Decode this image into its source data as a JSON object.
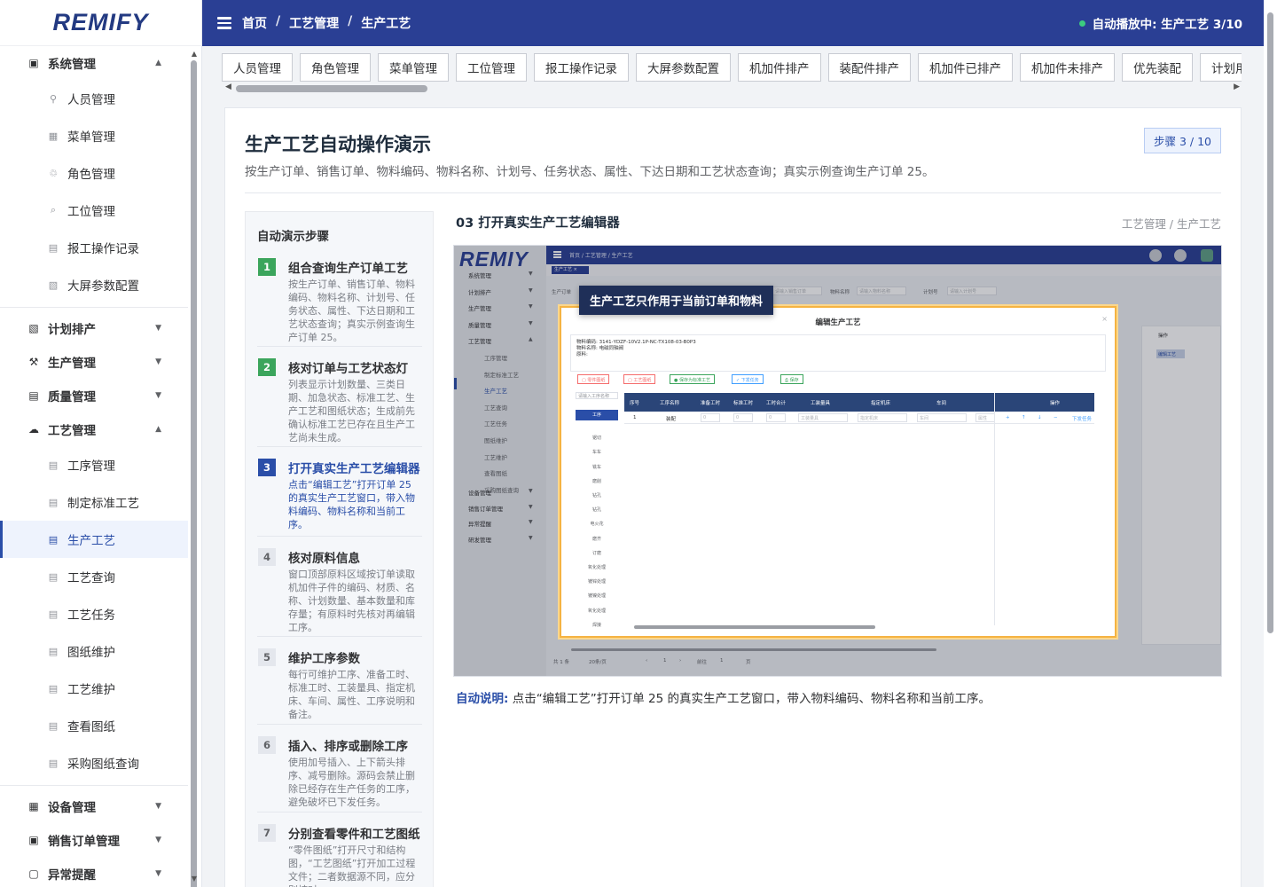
{
  "app": {
    "logo": "REMIFY"
  },
  "header": {
    "breadcrumbs": [
      "首页",
      "工艺管理",
      "生产工艺"
    ],
    "status": "自动播放中: 生产工艺 3/10",
    "status_color": "#3ccb7f"
  },
  "sidebar": {
    "items": [
      {
        "label": "系统管理",
        "level": "top",
        "icon": "square-dot-icon",
        "arrow": "▲"
      },
      {
        "label": "人员管理",
        "level": "sub",
        "icon": "person-icon"
      },
      {
        "label": "菜单管理",
        "level": "sub",
        "icon": "grid-icon"
      },
      {
        "label": "角色管理",
        "level": "sub",
        "icon": "users-icon"
      },
      {
        "label": "工位管理",
        "level": "sub",
        "icon": "search-icon"
      },
      {
        "label": "报工操作记录",
        "level": "sub",
        "icon": "list-icon"
      },
      {
        "label": "大屏参数配置",
        "level": "sub",
        "icon": "hatch-icon"
      },
      {
        "label": "计划排产",
        "level": "top",
        "icon": "hatch-icon",
        "arrow": "▼"
      },
      {
        "label": "生产管理",
        "level": "top",
        "icon": "tools-icon",
        "arrow": "▼"
      },
      {
        "label": "质量管理",
        "level": "top",
        "icon": "list-icon",
        "arrow": "▼"
      },
      {
        "label": "工艺管理",
        "level": "top",
        "icon": "cloud-icon",
        "arrow": "▲"
      },
      {
        "label": "工序管理",
        "level": "sub",
        "icon": "list-icon"
      },
      {
        "label": "制定标准工艺",
        "level": "sub",
        "icon": "list-icon"
      },
      {
        "label": "生产工艺",
        "level": "sub",
        "icon": "list-icon",
        "active": true
      },
      {
        "label": "工艺查询",
        "level": "sub",
        "icon": "list-icon"
      },
      {
        "label": "工艺任务",
        "level": "sub",
        "icon": "list-icon"
      },
      {
        "label": "图纸维护",
        "level": "sub",
        "icon": "list-icon"
      },
      {
        "label": "工艺维护",
        "level": "sub",
        "icon": "list-icon"
      },
      {
        "label": "查看图纸",
        "level": "sub",
        "icon": "list-icon"
      },
      {
        "label": "采购图纸查询",
        "level": "sub",
        "icon": "list-icon"
      },
      {
        "label": "设备管理",
        "level": "top",
        "icon": "grid-icon",
        "arrow": "▼"
      },
      {
        "label": "销售订单管理",
        "level": "top",
        "icon": "square-dot-icon",
        "arrow": "▼"
      },
      {
        "label": "异常提醒",
        "level": "top",
        "icon": "square-icon",
        "arrow": "▼"
      }
    ]
  },
  "tabs": [
    "人员管理",
    "角色管理",
    "菜单管理",
    "工位管理",
    "报工操作记录",
    "大屏参数配置",
    "机加件排产",
    "装配件排产",
    "机加件已排产",
    "机加件未排产",
    "优先装配",
    "计划用表"
  ],
  "page": {
    "title": "生产工艺自动操作演示",
    "description": "按生产订单、销售订单、物料编码、物料名称、计划号、任务状态、属性、下达日期和工艺状态查询；真实示例查询生产订单 25。",
    "step_badge": "步骤 3 / 10"
  },
  "steps_panel": {
    "heading": "自动演示步骤",
    "steps": [
      {
        "num": "1",
        "title": "组合查询生产订单工艺",
        "desc": "按生产订单、销售订单、物料编码、物料名称、计划号、任务状态、属性、下达日期和工艺状态查询；真实示例查询生产订单 25。",
        "state": "done"
      },
      {
        "num": "2",
        "title": "核对订单与工艺状态灯",
        "desc": "列表显示计划数量、三类日期、加急状态、标准工艺、生产工艺和图纸状态；生成前先确认标准工艺已存在且生产工艺尚未生成。",
        "state": "done"
      },
      {
        "num": "3",
        "title": "打开真实生产工艺编辑器",
        "desc": "点击“编辑工艺”打开订单 25 的真实生产工艺窗口，带入物料编码、物料名称和当前工序。",
        "state": "current"
      },
      {
        "num": "4",
        "title": "核对原料信息",
        "desc": "窗口顶部原料区域按订单读取机加件子件的编码、材质、名称、计划数量、基本数量和库存量；有原料时先核对再编辑工序。",
        "state": "todo"
      },
      {
        "num": "5",
        "title": "维护工序参数",
        "desc": "每行可维护工序、准备工时、标准工时、工装量具、指定机床、车间、属性、工序说明和备注。",
        "state": "todo"
      },
      {
        "num": "6",
        "title": "插入、排序或删除工序",
        "desc": "使用加号插入、上下箭头排序、减号删除。源码会禁止删除已经存在生产任务的工序，避免破坏已下发任务。",
        "state": "todo"
      },
      {
        "num": "7",
        "title": "分别查看零件和工艺图纸",
        "desc": "“零件图纸”打开尺寸和结构图，“工艺图纸”打开加工过程文件；二者数据源不同，应分别核对。",
        "state": "todo"
      }
    ]
  },
  "detail": {
    "title": "03 打开真实生产工艺编辑器",
    "breadcrumb": "工艺管理 / 生产工艺",
    "note_label": "自动说明:",
    "note_text": "点击“编辑工艺”打开订单 25 的真实生产工艺窗口，带入物料编码、物料名称和当前工序。"
  },
  "screenshot": {
    "logo": "REMIY",
    "header_crumb": "首页 / 工艺管理 / 生产工艺",
    "tab": "生产工艺 ×",
    "menu": [
      {
        "label": "系统管理",
        "level": "top",
        "arrow": "▼"
      },
      {
        "label": "计划排产",
        "level": "top",
        "arrow": "▼"
      },
      {
        "label": "生产管理",
        "level": "top",
        "arrow": "▼"
      },
      {
        "label": "质量管理",
        "level": "top",
        "arrow": "▼"
      },
      {
        "label": "工艺管理",
        "level": "top",
        "arrow": "▲"
      },
      {
        "label": "工序管理",
        "level": "sub"
      },
      {
        "label": "制定标准工艺",
        "level": "sub"
      },
      {
        "label": "生产工艺",
        "level": "sub",
        "active": true
      },
      {
        "label": "工艺查询",
        "level": "sub"
      },
      {
        "label": "工艺任务",
        "level": "sub"
      },
      {
        "label": "图纸维护",
        "level": "sub"
      },
      {
        "label": "工艺维护",
        "level": "sub"
      },
      {
        "label": "查看图纸",
        "level": "sub"
      },
      {
        "label": "采购图纸查询",
        "level": "sub"
      },
      {
        "label": "设备管理",
        "level": "top",
        "arrow": "▼"
      },
      {
        "label": "销售订单管理",
        "level": "top",
        "arrow": "▼"
      },
      {
        "label": "异常提醒",
        "level": "top",
        "arrow": "▼"
      },
      {
        "label": "研发管理",
        "level": "top",
        "arrow": "▼"
      }
    ],
    "filters": [
      {
        "label": "生产订单",
        "placeholder": ""
      },
      {
        "label": "",
        "placeholder": "请输入销售订单"
      },
      {
        "label": "物料名称",
        "placeholder": "请输入物料名称"
      },
      {
        "label": "计划号",
        "placeholder": "请输入计划号"
      }
    ],
    "right_col_header": "操作",
    "right_col_btn": "编辑工艺",
    "footer": [
      "共 1 条",
      "20条/页",
      "‹",
      "1",
      "›",
      "前往",
      "1",
      "页"
    ],
    "tooltip": "生产工艺只作用于当前订单和物料",
    "dialog": {
      "title": "编辑生产工艺",
      "close": "×",
      "info_lines": [
        "物料编码:  3141-YDZF-10V2.1P-NC-TX108-03-B0P3",
        "物料名称:  电磁同轴阀",
        "原料:"
      ],
      "buttons": [
        {
          "label": "▢ 零件图纸",
          "color": "#f56c6c"
        },
        {
          "label": "▢ 工艺图纸",
          "color": "#f56c6c"
        },
        {
          "label": "● 保存为标准工艺",
          "color": "#3ba55c"
        },
        {
          "label": "✓ 下发任务",
          "color": "#409eff"
        },
        {
          "label": "⎙ 保存",
          "color": "#3ba55c"
        }
      ],
      "search_placeholder": "请输入工序名称",
      "process_list": [
        "工序",
        "锯切",
        "车车",
        "铣车",
        "磨削",
        "钻孔",
        "钻孔",
        "电火花",
        "磨齐",
        "订磨",
        "氧化处理",
        "镀锌处理",
        "镀镍处理",
        "氧化处理",
        "焊接"
      ],
      "table_headers": [
        "序号",
        "工序名称",
        "准备工时",
        "标准工时",
        "工时合计",
        "工装量具",
        "指定机床",
        "车间",
        "操作"
      ],
      "row": {
        "no": "1",
        "name": "装配",
        "prep": "0",
        "std": "0",
        "total": "0",
        "tool_ph": "工装量具",
        "machine_ph": "指定机床",
        "shop_ph": "车间",
        "attr_ph": "属性",
        "op": "下发任务"
      },
      "ops_icons": [
        "+",
        "↑",
        "↓",
        "−"
      ]
    }
  }
}
